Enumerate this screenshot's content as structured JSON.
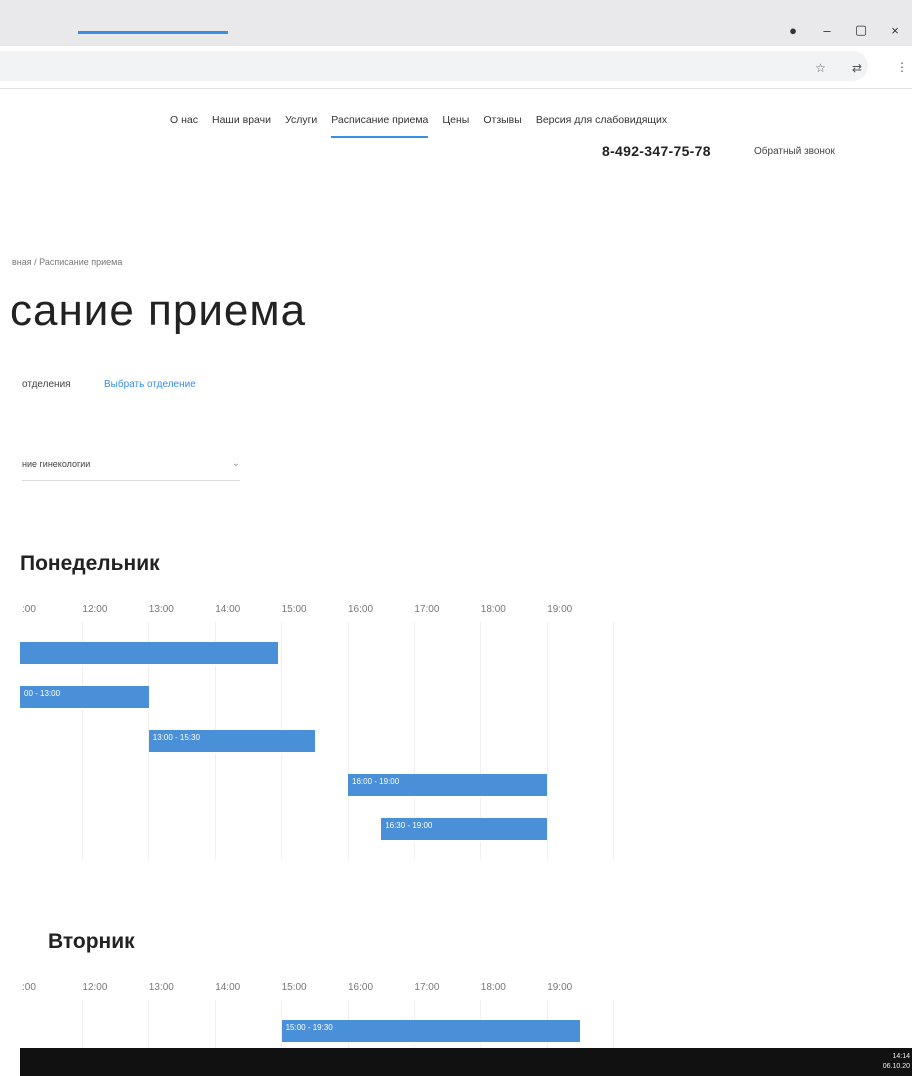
{
  "browser": {
    "window_controls": [
      "●",
      "–",
      "▢",
      "×"
    ],
    "addr_icons": [
      "☆",
      "⇄",
      "⋮"
    ]
  },
  "nav": {
    "items": [
      "О нас",
      "Наши врачи",
      "Услуги",
      "Расписание приема",
      "Цены",
      "Отзывы",
      "Версия для слабовидящих"
    ],
    "active_index": 3,
    "phone": "8-492-347-75-78",
    "callback": "Обратный звонок"
  },
  "breadcrumb": "вная / Расписание приема",
  "page_title": "сание приема",
  "tabs": [
    "отделения",
    "Выбрать отделение"
  ],
  "select": {
    "value": "ние гинекологии"
  },
  "days": [
    {
      "title": "Понедельник",
      "ticks": [
        ":00",
        "12:00",
        "13:00",
        "14:00",
        "15:00",
        "16:00",
        "17:00",
        "18:00",
        "19:00"
      ],
      "slots": [
        {
          "label": "",
          "start_hour": 11.0,
          "end_hour": 14.95
        },
        {
          "label": "00 - 13:00",
          "start_hour": 11.0,
          "end_hour": 13.0
        },
        {
          "label": "13:00 - 15:30",
          "start_hour": 13.0,
          "end_hour": 15.5
        },
        {
          "label": "16:00 - 19:00",
          "start_hour": 16.0,
          "end_hour": 19.0
        },
        {
          "label": "16:30 - 19:00",
          "start_hour": 16.5,
          "end_hour": 19.0
        }
      ]
    },
    {
      "title": "Вторник",
      "ticks": [
        ":00",
        "12:00",
        "13:00",
        "14:00",
        "15:00",
        "16:00",
        "17:00",
        "18:00",
        "19:00"
      ],
      "slots": [
        {
          "label": "15:00 - 19:30",
          "start_hour": 15.0,
          "end_hour": 19.5
        }
      ]
    }
  ],
  "taskbar": {
    "time": "14:14",
    "date": "06.10.20"
  }
}
